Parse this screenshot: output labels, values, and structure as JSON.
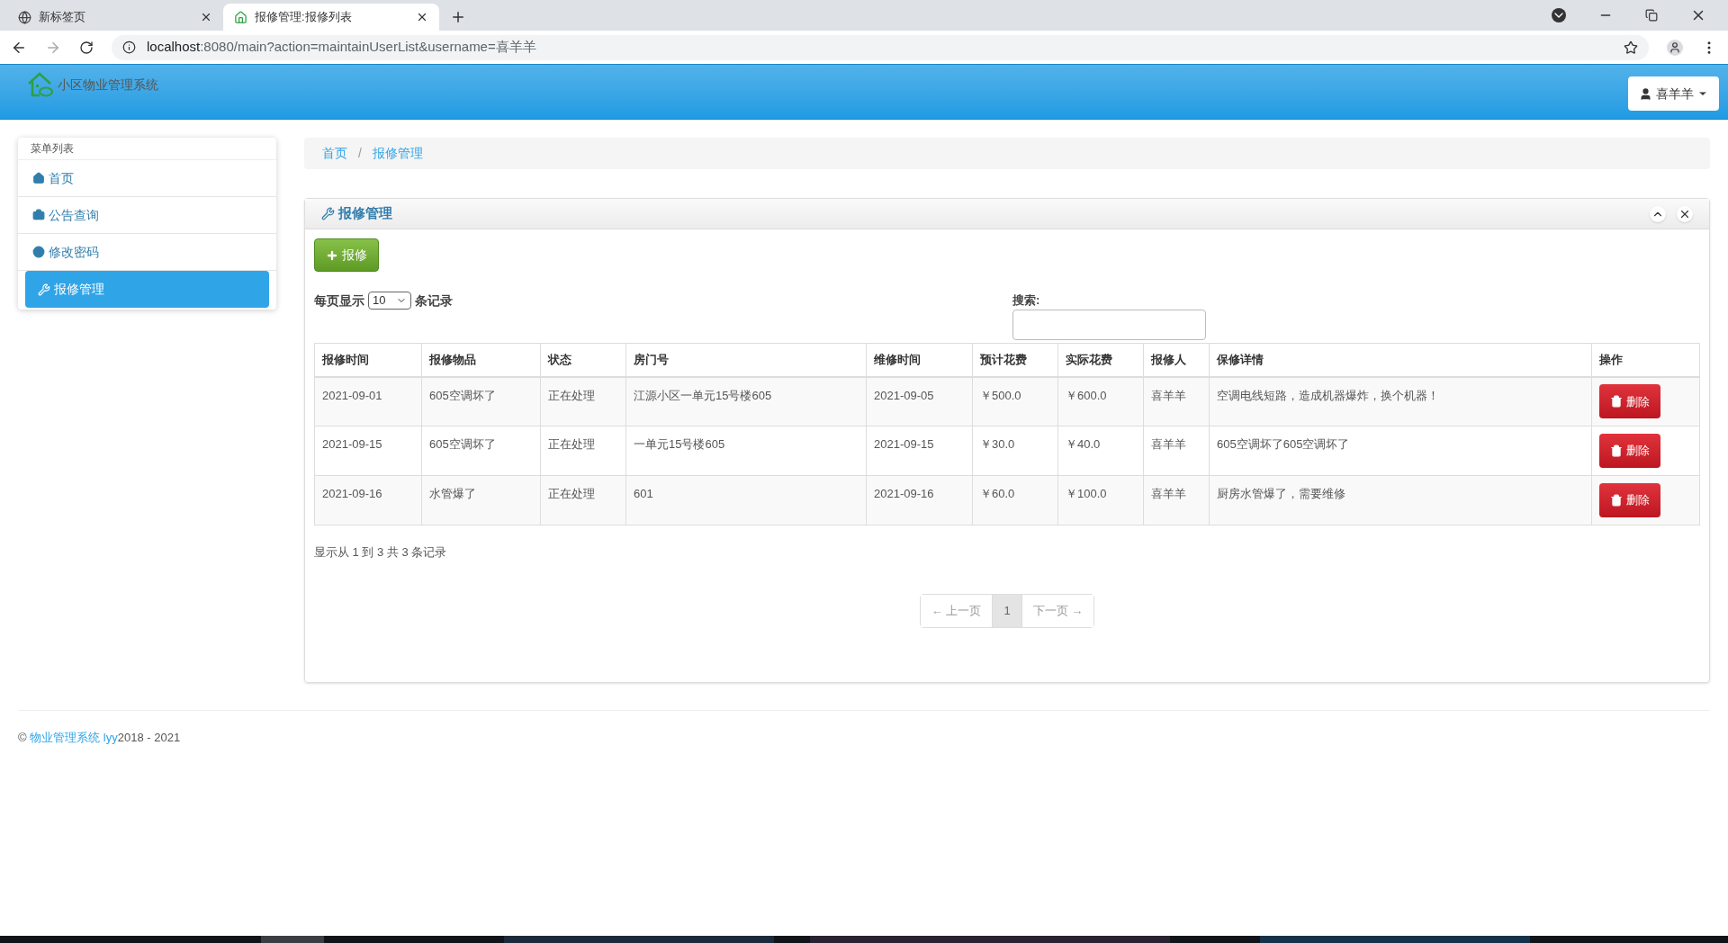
{
  "browser": {
    "tabs": [
      {
        "title": "新标签页",
        "selected": false
      },
      {
        "title": "报修管理:报修列表",
        "selected": true
      }
    ],
    "url_host": "localhost",
    "url_rest": ":8080/main?action=maintainUserList&username=喜羊羊"
  },
  "navbar": {
    "brand": "小区物业管理系统",
    "user": "喜羊羊"
  },
  "sidebar": {
    "title": "菜单列表",
    "items": [
      {
        "label": "首页",
        "selected": false
      },
      {
        "label": "公告查询",
        "selected": false
      },
      {
        "label": "修改密码",
        "selected": false
      },
      {
        "label": "报修管理",
        "selected": true
      }
    ]
  },
  "breadcrumb": {
    "separator": "/",
    "items": [
      {
        "label": "首页"
      },
      {
        "label": "报修管理"
      }
    ]
  },
  "panel": {
    "title": "报修管理",
    "add_button": "报修",
    "page_size_prefix": "每页显示",
    "page_size": "10",
    "page_size_suffix": "条记录",
    "search_label": "搜索:",
    "table": {
      "columns": [
        "报修时间",
        "报修物品",
        "状态",
        "房门号",
        "维修时间",
        "预计花费",
        "实际花费",
        "报修人",
        "保修详情",
        "操作"
      ],
      "rows": [
        [
          "2021-09-01",
          "605空调坏了",
          "正在处理",
          "江源小区一单元15号楼605",
          "2021-09-05",
          "￥500.0",
          "￥600.0",
          "喜羊羊",
          "空调电线短路，造成机器爆炸，换个机器！",
          "删除"
        ],
        [
          "2021-09-15",
          "605空调坏了",
          "正在处理",
          "一单元15号楼605",
          "2021-09-15",
          "￥30.0",
          "￥40.0",
          "喜羊羊",
          "605空调坏了605空调坏了",
          "删除"
        ],
        [
          "2021-09-16",
          "水管爆了",
          "正在处理",
          "601",
          "2021-09-16",
          "￥60.0",
          "￥100.0",
          "喜羊羊",
          "厨房水管爆了，需要维修",
          "删除"
        ]
      ]
    },
    "info": "显示从 1 到 3 共 3 条记录",
    "pagination": [
      {
        "label": "← 上一页",
        "selected": false
      },
      {
        "label": "1",
        "selected": true
      },
      {
        "label": "下一页 →",
        "selected": false
      }
    ]
  },
  "footer": {
    "copyright": "©",
    "link": "物业管理系统 lyy",
    "years": "2018 - 2021"
  }
}
